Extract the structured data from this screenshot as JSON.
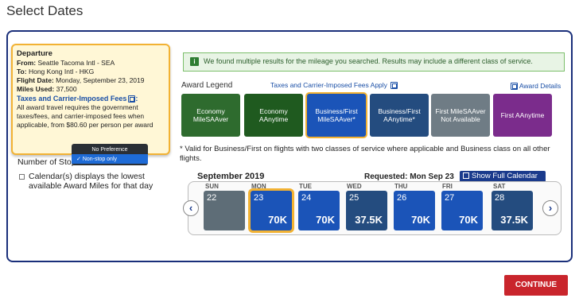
{
  "page_title": "Select Dates",
  "departure": {
    "heading": "Departure",
    "from_label": "From:",
    "from": "Seattle Tacoma Intl - SEA",
    "to_label": "To:",
    "to": "Hong Kong Intl - HKG",
    "date_label": "Flight Date:",
    "date": "Monday, September 23, 2019",
    "miles_label": "Miles Used:",
    "miles": "37,500",
    "tax_heading": "Taxes and Carrier-Imposed Fees",
    "tax_colon": ":",
    "tax_text": "All award travel requires the government taxes/fees, and carrier-imposed fees when applicable, from $80.60 per person per award"
  },
  "stops_dropdown": {
    "options": [
      "No Preference",
      "Non-stop only"
    ],
    "selected": "Non-stop only"
  },
  "stops_label": "Number of Stops",
  "calendar_note": "Calendar(s) displays the lowest available Award Miles for that day",
  "notice": "We found multiple results for the mileage you searched. Results may include a different class of service.",
  "award_legend": "Award Legend",
  "tax_link": "Taxes and Carrier-Imposed Fees Apply",
  "award_details": "Award Details",
  "legend_items": [
    {
      "label": "Economy MileSAAver",
      "color": "#2e6b2e"
    },
    {
      "label": "Economy AAnytime",
      "color": "#1f5a1f"
    },
    {
      "label": "Business/First MileSAAver*",
      "color": "#1b54b8"
    },
    {
      "label": "Business/First AAnytime*",
      "color": "#244c7f"
    },
    {
      "label": "First MileSAAver Not Available",
      "color": "#6f7c85"
    },
    {
      "label": "First AAnytime",
      "color": "#7b2c8c"
    }
  ],
  "footnote": "* Valid for Business/First on flights with two classes of service where applicable and Business class on all other flights.",
  "calendar": {
    "month": "September 2019",
    "requested": "Requested: Mon Sep 23",
    "show_full": "Show Full Calendar",
    "days": [
      {
        "dow": "SUN",
        "num": "22",
        "miles": "",
        "color": "#5e6d77"
      },
      {
        "dow": "MON",
        "num": "23",
        "miles": "70K",
        "color": "#1b54b8",
        "selected": true
      },
      {
        "dow": "TUE",
        "num": "24",
        "miles": "70K",
        "color": "#1b54b8"
      },
      {
        "dow": "WED",
        "num": "25",
        "miles": "37.5K",
        "color": "#244c7f"
      },
      {
        "dow": "THU",
        "num": "26",
        "miles": "70K",
        "color": "#1b54b8"
      },
      {
        "dow": "FRI",
        "num": "27",
        "miles": "70K",
        "color": "#1b54b8"
      },
      {
        "dow": "SAT",
        "num": "28",
        "miles": "37.5K",
        "color": "#244c7f"
      }
    ]
  },
  "nav": {
    "prev": "‹",
    "next": "›"
  },
  "continue_label": "CONTINUE",
  "colors": {
    "panel_border": "#1a2f7a",
    "highlight": "#f2b233",
    "continue": "#c9252c"
  }
}
